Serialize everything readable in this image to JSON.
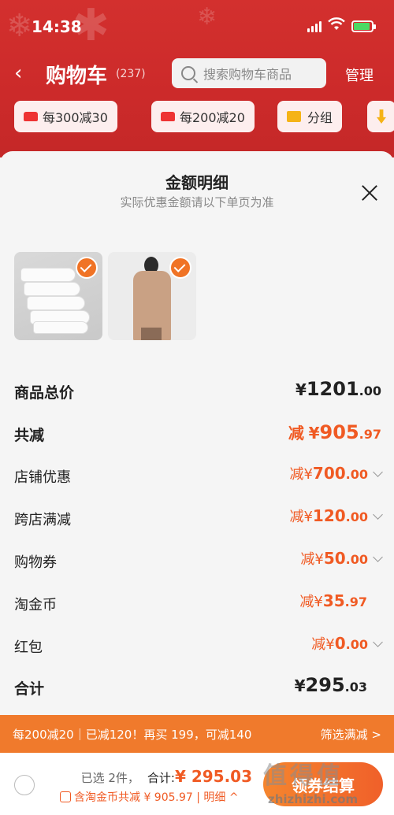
{
  "status": {
    "time": "14:38"
  },
  "header": {
    "title": "购物车",
    "count": "(237)",
    "search_placeholder": "搜索购物车商品",
    "manage": "管理"
  },
  "filters": [
    {
      "label": "每300减30"
    },
    {
      "label": "每200减20"
    },
    {
      "label": "分组"
    }
  ],
  "sheet": {
    "title": "金额明细",
    "subtitle": "实际优惠金额请以下单页为准",
    "items": [
      {
        "name": "socks",
        "checked": true
      },
      {
        "name": "coat",
        "checked": true
      }
    ],
    "rows": {
      "total_price": {
        "label": "商品总价",
        "symbol": "¥",
        "int": "1201",
        "dec": ".00"
      },
      "total_discount": {
        "label": "共减",
        "prefix": "减",
        "symbol": "¥",
        "int": "905",
        "dec": ".97"
      },
      "store_discount": {
        "label": "店铺优惠",
        "prefix": "减",
        "symbol": "¥",
        "int": "700",
        "dec": ".00"
      },
      "cross_store": {
        "label": "跨店满减",
        "prefix": "减",
        "symbol": "¥",
        "int": "120",
        "dec": ".00"
      },
      "voucher": {
        "label": "购物券",
        "prefix": "减",
        "symbol": "¥",
        "int": "50",
        "dec": ".00"
      },
      "coins": {
        "label": "淘金币",
        "prefix": "减",
        "symbol": "¥",
        "int": "35",
        "dec": ".97"
      },
      "red_packet": {
        "label": "红包",
        "prefix": "减",
        "symbol": "¥",
        "int": "0",
        "dec": ".00"
      },
      "grand_total": {
        "label": "合计",
        "symbol": "¥",
        "int": "295",
        "dec": ".03"
      }
    }
  },
  "promo": {
    "text": "每200减20｜已减120！再买 199，可减140",
    "action": "筛选满减 >"
  },
  "bottom": {
    "selected": "已选 2件，",
    "total_label": "合计:",
    "total_price": "¥ 295.03",
    "coin_text": "含淘金币共减 ¥ 905.97 | 明细 ^",
    "checkout": "领券结算"
  },
  "watermark": {
    "text": "值得值",
    "url": "zhizhizhi.com"
  },
  "colors": {
    "accent": "#f05a23",
    "header": "#cc2a2a",
    "promo": "#f07a2c"
  }
}
